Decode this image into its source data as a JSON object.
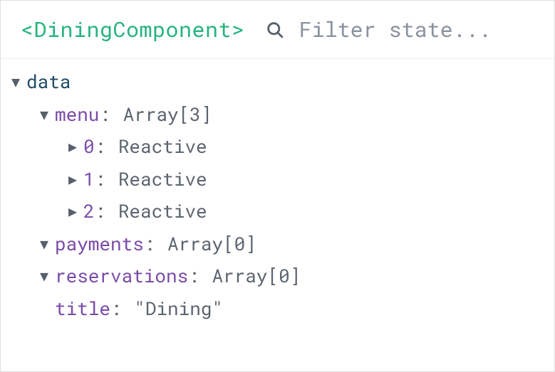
{
  "header": {
    "component_name": "<DiningComponent>",
    "filter_placeholder": "Filter state..."
  },
  "tree": {
    "root": {
      "label": "data",
      "expanded": true
    },
    "menu": {
      "key": "menu",
      "value": "Array[3]",
      "expanded": true,
      "items": [
        {
          "index": "0",
          "value": "Reactive",
          "expanded": false
        },
        {
          "index": "1",
          "value": "Reactive",
          "expanded": false
        },
        {
          "index": "2",
          "value": "Reactive",
          "expanded": false
        }
      ]
    },
    "payments": {
      "key": "payments",
      "value": "Array[0]",
      "expanded": true
    },
    "reservations": {
      "key": "reservations",
      "value": "Array[0]",
      "expanded": true
    },
    "title": {
      "key": "title",
      "value": "\"Dining\""
    }
  },
  "glyphs": {
    "down": "▼",
    "right": "▶"
  }
}
